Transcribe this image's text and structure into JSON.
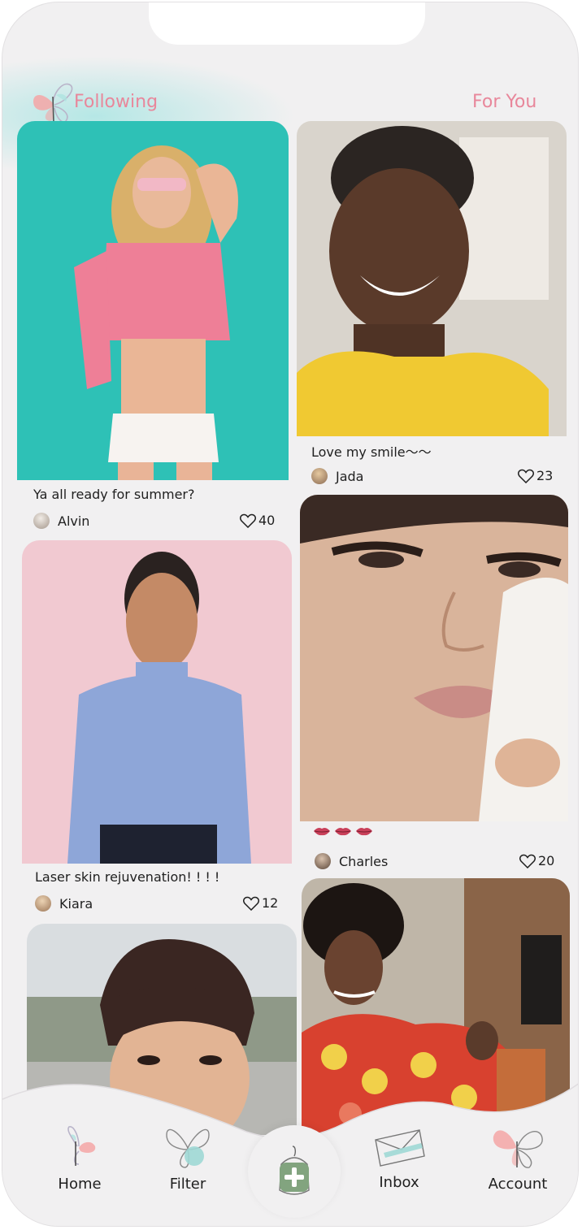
{
  "header": {
    "tab_following": "Following",
    "tab_for_you": "For You"
  },
  "feed": [
    {
      "caption": "Ya all ready for summer?",
      "user": "Alvin",
      "likes": "40"
    },
    {
      "caption": "Love my smile～～",
      "user": "Jada",
      "likes": "23"
    },
    {
      "caption": "Laser skin rejuvenation! ! ! !",
      "user": "Kiara",
      "likes": "12"
    },
    {
      "caption": "",
      "user": "Charles",
      "likes": "20"
    }
  ],
  "nav": {
    "home": "Home",
    "filter": "Filter",
    "inbox": "Inbox",
    "account": "Account"
  },
  "colors": {
    "accent_pink": "#e8879b",
    "teal": "#2ec5bb",
    "background": "#f1f0f1"
  }
}
